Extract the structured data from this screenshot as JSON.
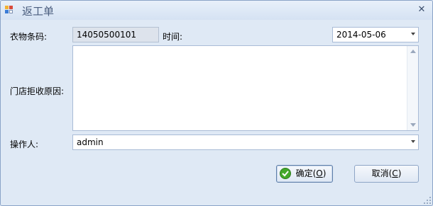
{
  "window": {
    "title": "返工单",
    "close_glyph": "✕"
  },
  "form": {
    "barcode_label": "衣物条码:",
    "barcode_value": "14050500101",
    "time_label": "时间:",
    "time_value": "2014-05-06",
    "reason_label": "门店拒收原因:",
    "reason_value": "",
    "operator_label": "操作人:",
    "operator_value": "admin"
  },
  "buttons": {
    "ok_label": "确定(",
    "ok_key": "O",
    "ok_suffix": ")",
    "cancel_label": "取消(",
    "cancel_key": "C",
    "cancel_suffix": ")"
  },
  "icons": {
    "app": "app-icon",
    "close": "close-icon",
    "ok": "check-icon",
    "dropdown": "chevron-down-icon"
  },
  "colors": {
    "window_bg": "#dfe9f5",
    "border": "#8aa3c7",
    "ok_icon": "#43a82b",
    "title_text": "#4a5d7e"
  }
}
